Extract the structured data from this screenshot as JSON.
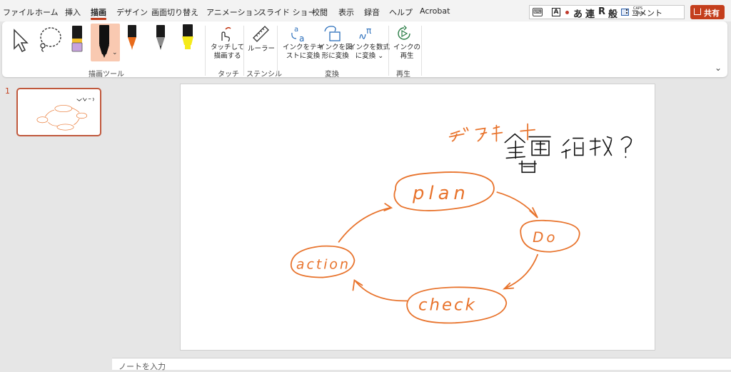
{
  "menu": {
    "tabs": [
      "ファイル",
      "ホーム",
      "挿入",
      "描画",
      "デザイン",
      "画面切り替え",
      "アニメーション",
      "スライド ショー",
      "校閲",
      "表示",
      "録音",
      "ヘルプ",
      "Acrobat"
    ],
    "active_tab": "描画"
  },
  "ime": {
    "mode": "あ",
    "ren": "連",
    "r": "R",
    "han": "般",
    "caps": "CAPS",
    "kana": "KANA"
  },
  "comment_label": "コメント",
  "share_label": "共有",
  "ribbon": {
    "groups": {
      "tools": "描画ツール",
      "touch": "タッチ",
      "stencil": "ステンシル",
      "convert": "変換",
      "replay": "再生"
    },
    "touch_draw": [
      "タッチして",
      "描画する"
    ],
    "ruler": "ルーラー",
    "ink_to_text": [
      "インクをテキ",
      "ストに変換"
    ],
    "ink_to_shape": [
      "インクを図",
      "形に変換"
    ],
    "ink_to_math": [
      "インクを数式",
      "に変換 ⌄"
    ],
    "ink_replay": [
      "インクの",
      "再生"
    ]
  },
  "thumbnail": {
    "number": "1"
  },
  "slide": {
    "annotation_top": "デフォルト",
    "annotation_main": "全画 領域？",
    "nodes": {
      "plan": "plan",
      "do": "Do",
      "check": "check",
      "action": "action"
    }
  },
  "notes_placeholder": "ノートを入力",
  "colors": {
    "accent": "#c43e1c",
    "ink": "#e8732c",
    "thumb_border": "#c0583c"
  }
}
